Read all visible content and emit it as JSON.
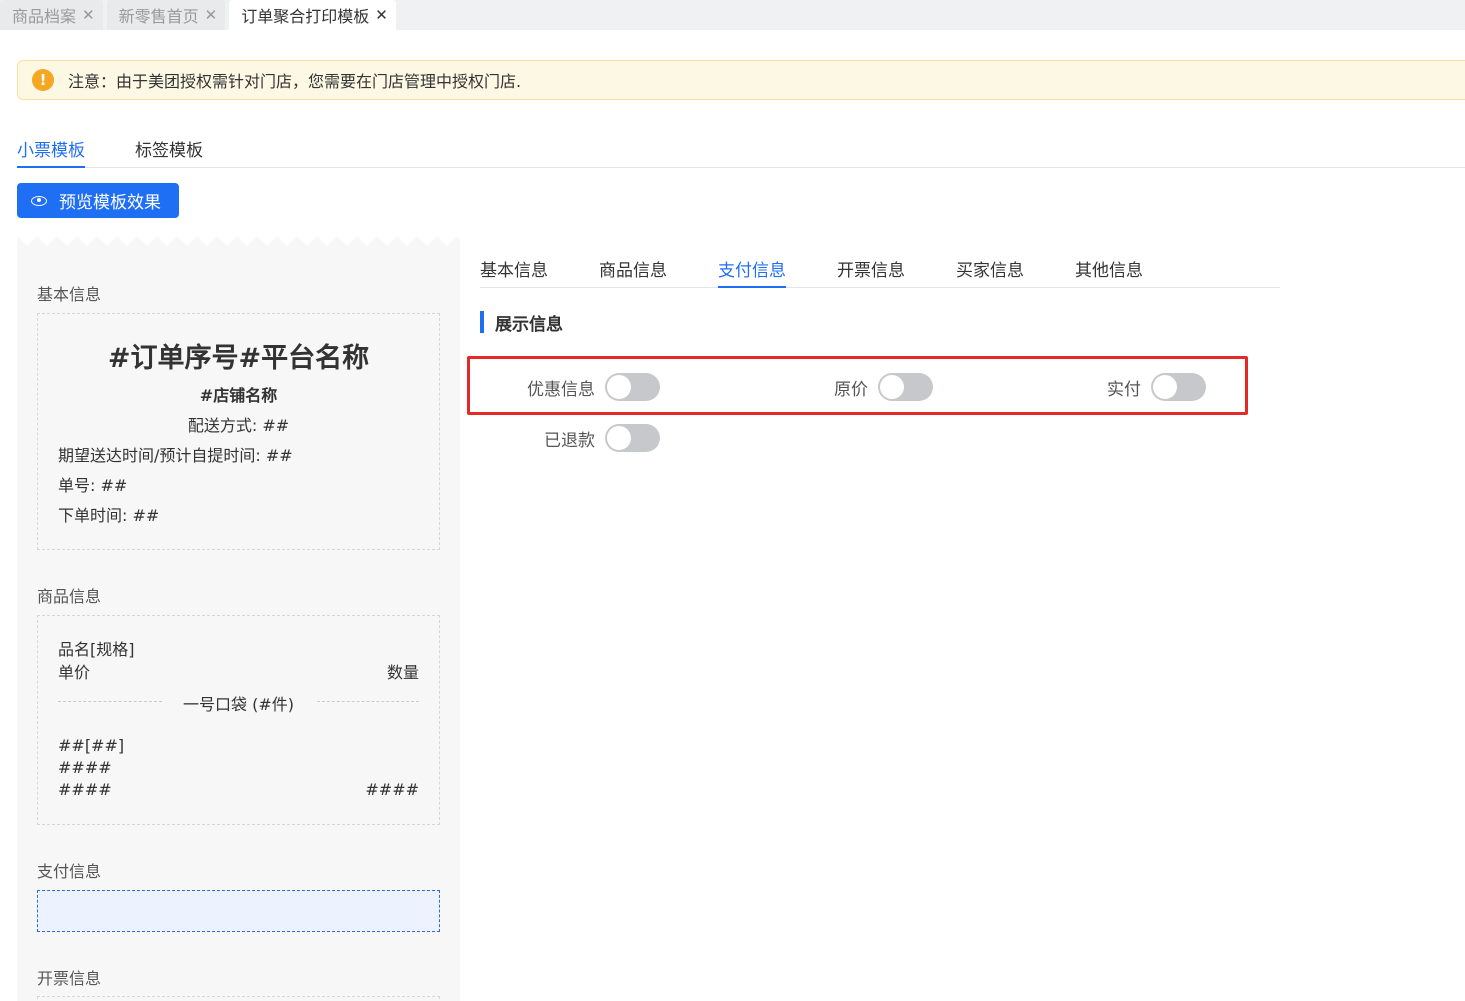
{
  "top_tabs": [
    {
      "label": "商品档案",
      "active": false
    },
    {
      "label": "新零售首页",
      "active": false
    },
    {
      "label": "订单聚合打印模板",
      "active": true
    }
  ],
  "notice": {
    "icon": "warning-circle-icon",
    "text": "注意：由于美团授权需针对门店，您需要在门店管理中授权门店."
  },
  "template_tabs": [
    {
      "label": "小票模板",
      "active": true
    },
    {
      "label": "标签模板",
      "active": false
    }
  ],
  "preview_button": {
    "label": "预览模板效果",
    "icon": "eye-icon"
  },
  "receipt": {
    "basic": {
      "label": "基本信息",
      "title": "#订单序号#平台名称",
      "shop": "#店铺名称",
      "delivery": "配送方式: ##",
      "expected_time": "期望送达时间/预计自提时间: ##",
      "order_no": "单号: ##",
      "order_time": "下单时间: ##"
    },
    "goods": {
      "label": "商品信息",
      "name_spec": "品名[规格]",
      "unit_price": "单价",
      "quantity": "数量",
      "bag": "一号口袋 (#件)",
      "row1": "##[##]",
      "row2": "####",
      "row3_left": "####",
      "row3_right": "####"
    },
    "payment": {
      "label": "支付信息"
    },
    "invoice": {
      "label": "开票信息"
    }
  },
  "sub_tabs": [
    {
      "label": "基本信息",
      "active": false
    },
    {
      "label": "商品信息",
      "active": false
    },
    {
      "label": "支付信息",
      "active": true
    },
    {
      "label": "开票信息",
      "active": false
    },
    {
      "label": "买家信息",
      "active": false
    },
    {
      "label": "其他信息",
      "active": false
    }
  ],
  "display_section": {
    "title": "展示信息",
    "options": [
      {
        "label": "优惠信息",
        "on": false
      },
      {
        "label": "原价",
        "on": false
      },
      {
        "label": "实付",
        "on": false
      },
      {
        "label": "已退款",
        "on": false
      }
    ]
  }
}
